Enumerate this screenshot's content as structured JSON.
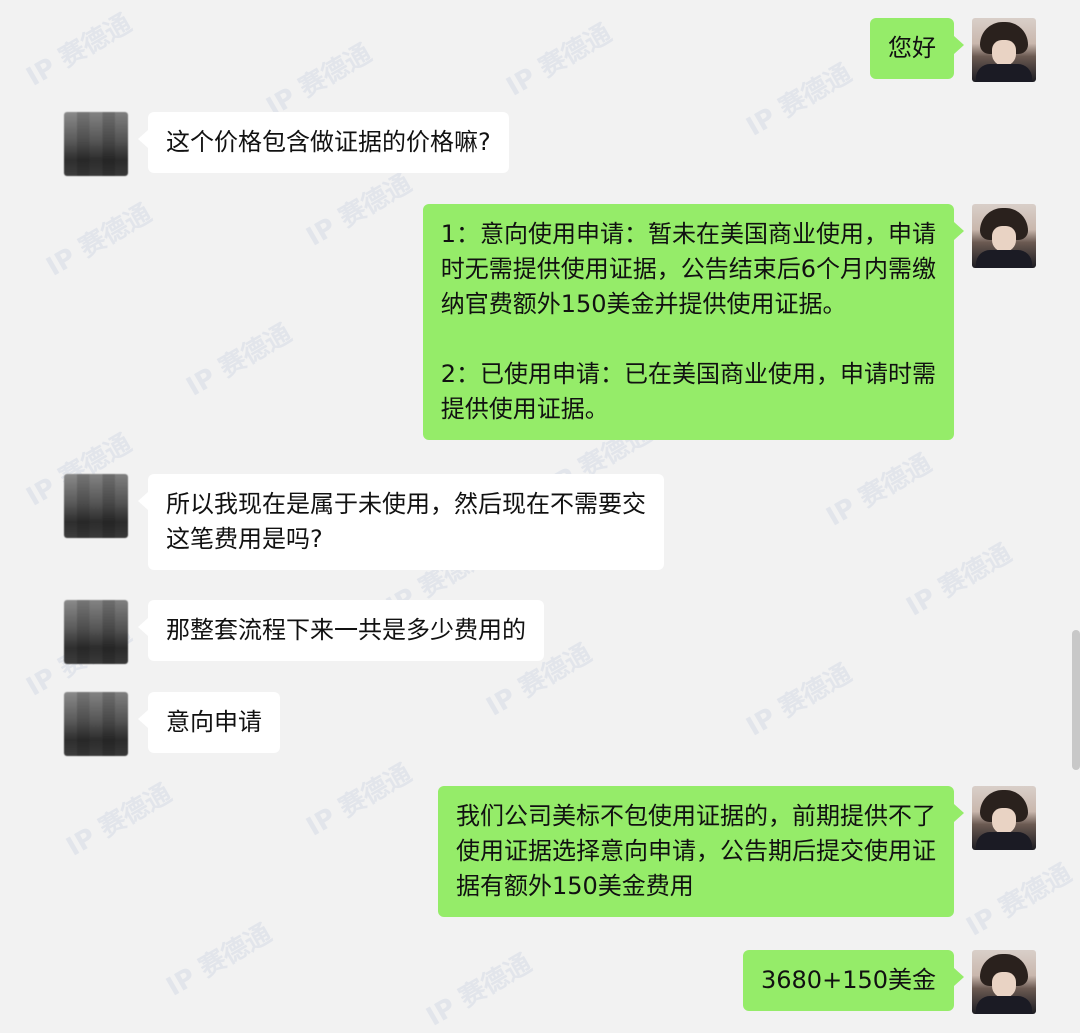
{
  "colors": {
    "background": "#f2f2f2",
    "incoming_bubble": "#ffffff",
    "outgoing_bubble": "#95ec69"
  },
  "watermark": {
    "text": "IP 赛德通"
  },
  "messages": [
    {
      "side": "out",
      "text": "您好"
    },
    {
      "side": "in",
      "text": "这个价格包含做证据的价格嘛?"
    },
    {
      "side": "out",
      "text": "1：意向使用申请：暂未在美国商业使用，申请\n时无需提供使用证据，公告结束后6个月内需缴\n纳官费额外150美金并提供使用证据。\n\n2：已使用申请：已在美国商业使用，申请时需\n提供使用证据。"
    },
    {
      "side": "in",
      "text": "所以我现在是属于未使用，然后现在不需要交\n这笔费用是吗?"
    },
    {
      "side": "in",
      "text": "那整套流程下来一共是多少费用的"
    },
    {
      "side": "in",
      "text": "意向申请"
    },
    {
      "side": "out",
      "text": "我们公司美标不包使用证据的，前期提供不了\n使用证据选择意向申请，公告期后提交使用证\n据有额外150美金费用"
    },
    {
      "side": "out",
      "text": "3680+150美金"
    }
  ]
}
